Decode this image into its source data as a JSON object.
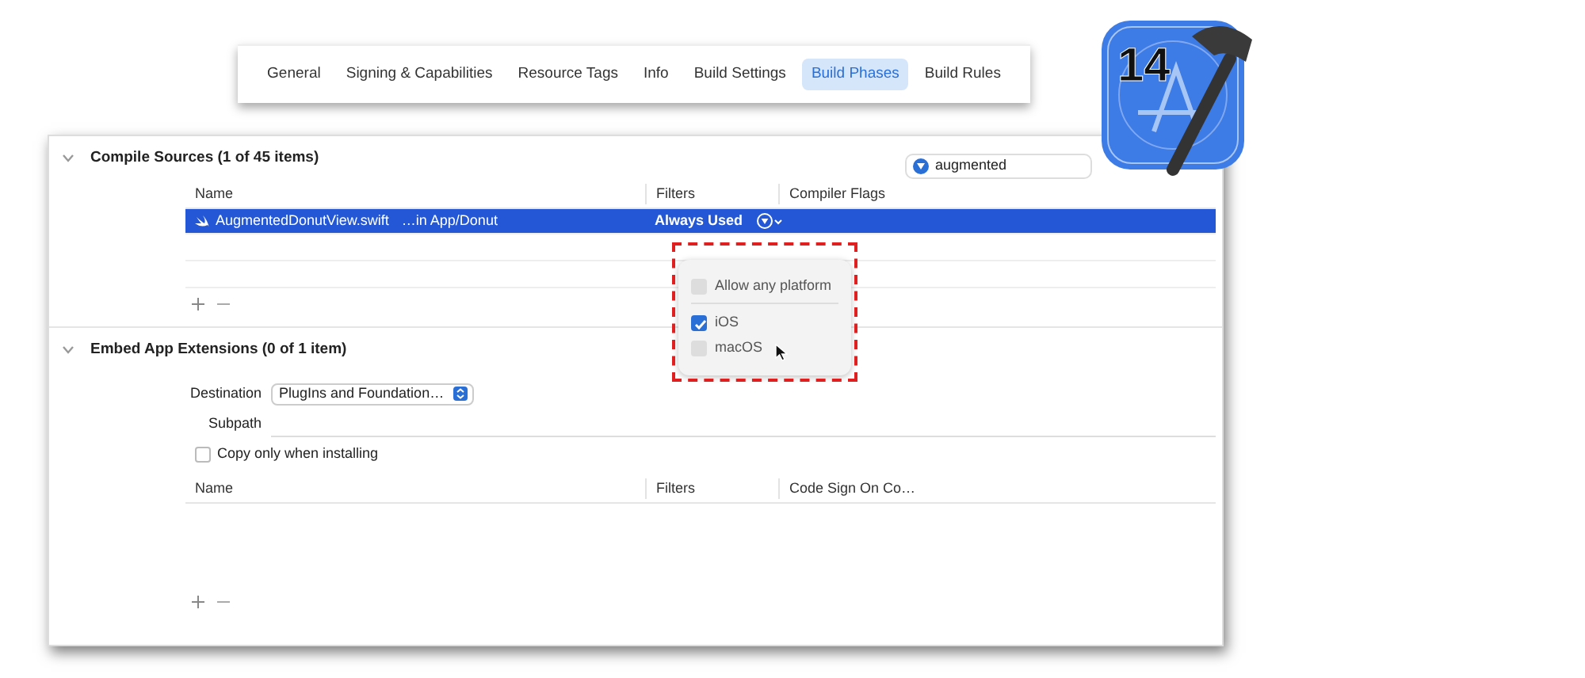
{
  "tabs": [
    {
      "label": "General",
      "selected": false
    },
    {
      "label": "Signing & Capabilities",
      "selected": false
    },
    {
      "label": "Resource Tags",
      "selected": false
    },
    {
      "label": "Info",
      "selected": false
    },
    {
      "label": "Build Settings",
      "selected": false
    },
    {
      "label": "Build Phases",
      "selected": true
    },
    {
      "label": "Build Rules",
      "selected": false
    }
  ],
  "app_icon": {
    "version": "14"
  },
  "compile_sources": {
    "title": "Compile Sources (1 of 45 items)",
    "expanded": true,
    "search": {
      "value": "augmented"
    },
    "columns": [
      "Name",
      "Filters",
      "Compiler Flags"
    ],
    "rows": [
      {
        "name": "AugmentedDonutView.swift",
        "path": "…in App/Donut",
        "filters": "Always Used",
        "selected": true
      }
    ]
  },
  "platform_popover": {
    "options": [
      {
        "label": "Allow any platform",
        "checked": false
      },
      {
        "label": "iOS",
        "checked": true
      },
      {
        "label": "macOS",
        "checked": false
      }
    ]
  },
  "embed_app_extensions": {
    "title": "Embed App Extensions (0 of 1 item)",
    "expanded": true,
    "destination_label": "Destination",
    "destination": "PlugIns and Foundation…",
    "subpath_label": "Subpath",
    "copy_only": {
      "label": "Copy only when installing",
      "checked": false
    },
    "columns": [
      "Name",
      "Filters",
      "Code Sign On Co…"
    ]
  }
}
